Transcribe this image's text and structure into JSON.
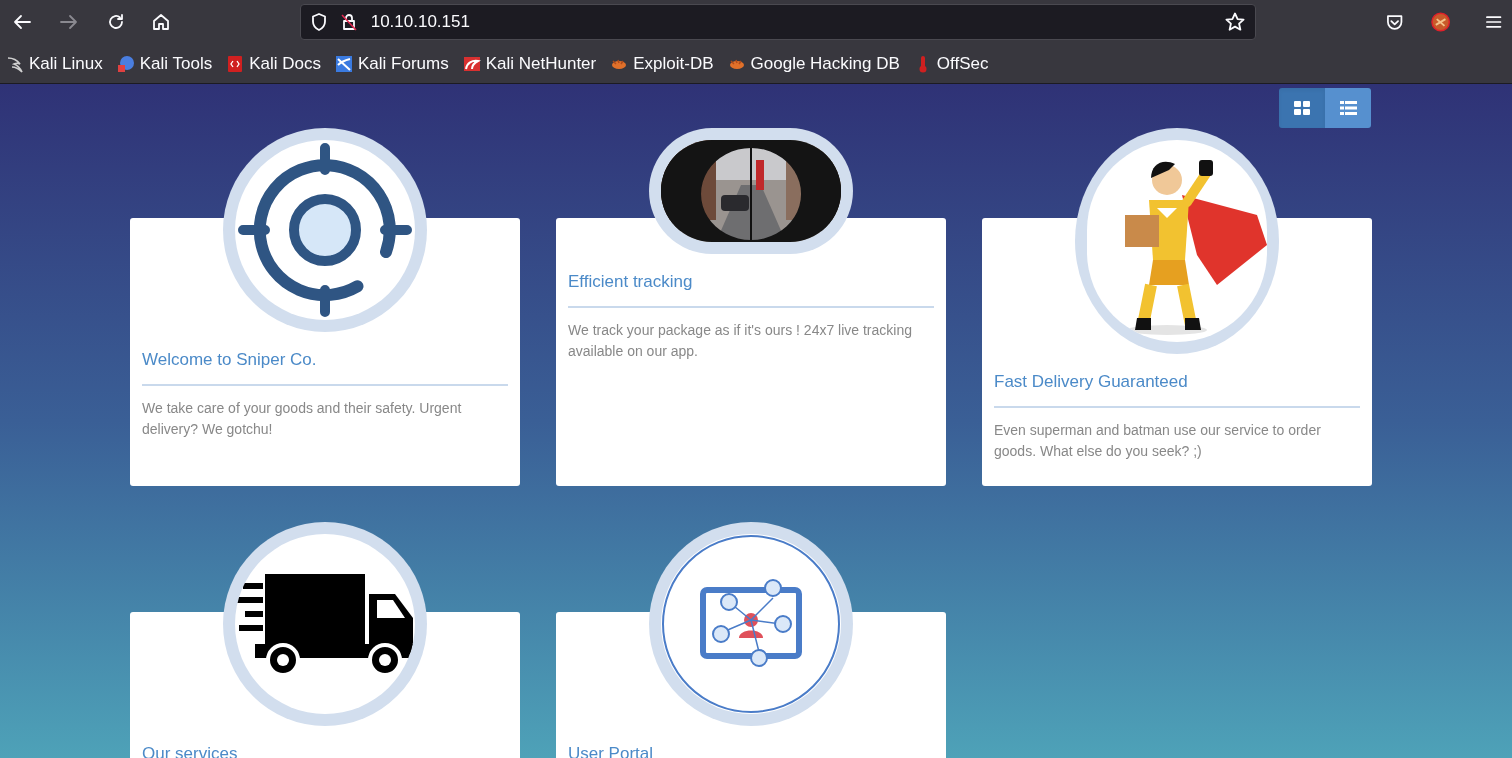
{
  "browser": {
    "url": "10.10.10.151",
    "bookmarks": [
      {
        "label": "Kali Linux"
      },
      {
        "label": "Kali Tools"
      },
      {
        "label": "Kali Docs"
      },
      {
        "label": "Kali Forums"
      },
      {
        "label": "Kali NetHunter"
      },
      {
        "label": "Exploit-DB"
      },
      {
        "label": "Google Hacking DB"
      },
      {
        "label": "OffSec"
      }
    ]
  },
  "view_toggle": [
    {
      "kind": "grid",
      "selected": true
    },
    {
      "kind": "list",
      "selected": false
    }
  ],
  "cards": [
    {
      "kind": "crosshair",
      "title": "Welcome to Sniper Co.",
      "text": "We take care of your goods and their safety. Urgent delivery? We gotchu!"
    },
    {
      "kind": "picture",
      "title": "Efficient tracking",
      "text": "We track your package as if it's ours ! 24x7 live tracking available on our app."
    },
    {
      "kind": "hero",
      "title": "Fast Delivery Guaranteed",
      "text": "Even superman and batman use our service to order goods. What else do you seek? ;)"
    },
    {
      "kind": "truck",
      "title": "Our services"
    },
    {
      "kind": "portal",
      "title": "User Portal"
    }
  ]
}
